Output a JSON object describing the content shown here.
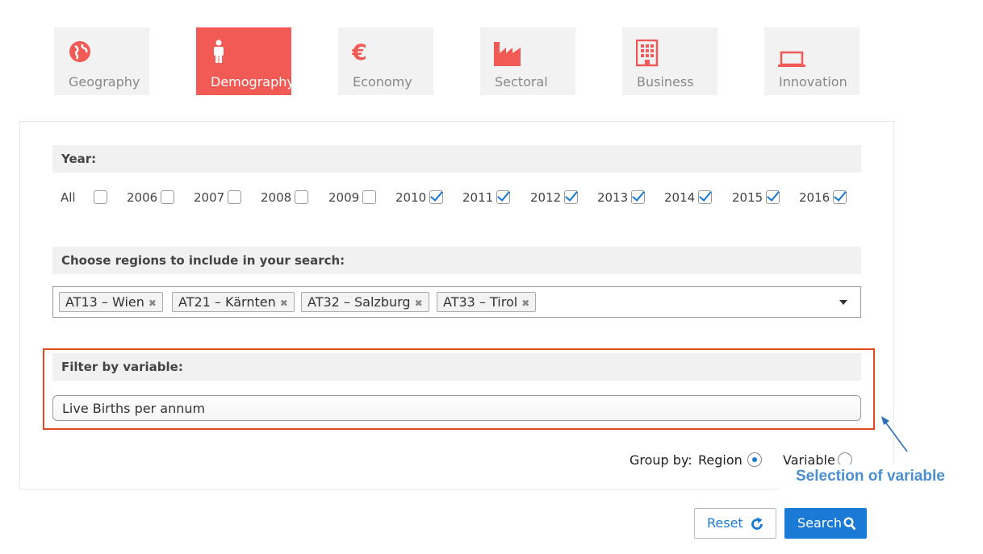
{
  "tabs": [
    {
      "label": "Geography",
      "icon": "globe-icon",
      "active": false
    },
    {
      "label": "Demography",
      "icon": "person-icon",
      "active": true
    },
    {
      "label": "Economy",
      "icon": "euro-icon",
      "active": false
    },
    {
      "label": "Sectoral",
      "icon": "factory-icon",
      "active": false
    },
    {
      "label": "Business",
      "icon": "building-icon",
      "active": false
    },
    {
      "label": "Innovation",
      "icon": "laptop-icon",
      "active": false
    }
  ],
  "year_section": {
    "heading": "Year:",
    "all_label": "All",
    "years": [
      {
        "label": "2006",
        "checked": false
      },
      {
        "label": "2007",
        "checked": false
      },
      {
        "label": "2008",
        "checked": false
      },
      {
        "label": "2009",
        "checked": false
      },
      {
        "label": "2010",
        "checked": true
      },
      {
        "label": "2011",
        "checked": true
      },
      {
        "label": "2012",
        "checked": true
      },
      {
        "label": "2013",
        "checked": true
      },
      {
        "label": "2014",
        "checked": true
      },
      {
        "label": "2015",
        "checked": true
      },
      {
        "label": "2016",
        "checked": true
      }
    ]
  },
  "region_section": {
    "heading": "Choose regions to include in your search:",
    "selected": [
      "AT13 – Wien",
      "AT21 – Kärnten",
      "AT32 – Salzburg",
      "AT33 – Tirol"
    ],
    "remove_glyph": "✖"
  },
  "variable_section": {
    "heading": "Filter by variable:",
    "value": "Live Births per annum"
  },
  "group_by": {
    "label": "Group by:",
    "options": [
      {
        "label": "Region",
        "selected": true
      },
      {
        "label": "Variable",
        "selected": false
      }
    ]
  },
  "annotation": "Selection of variable",
  "buttons": {
    "reset": "Reset",
    "search": "Search"
  },
  "colors": {
    "accent": "#f25a55",
    "primary": "#1a7ad6",
    "highlight": "#e14a1e",
    "annotation": "#4a8fd0"
  }
}
